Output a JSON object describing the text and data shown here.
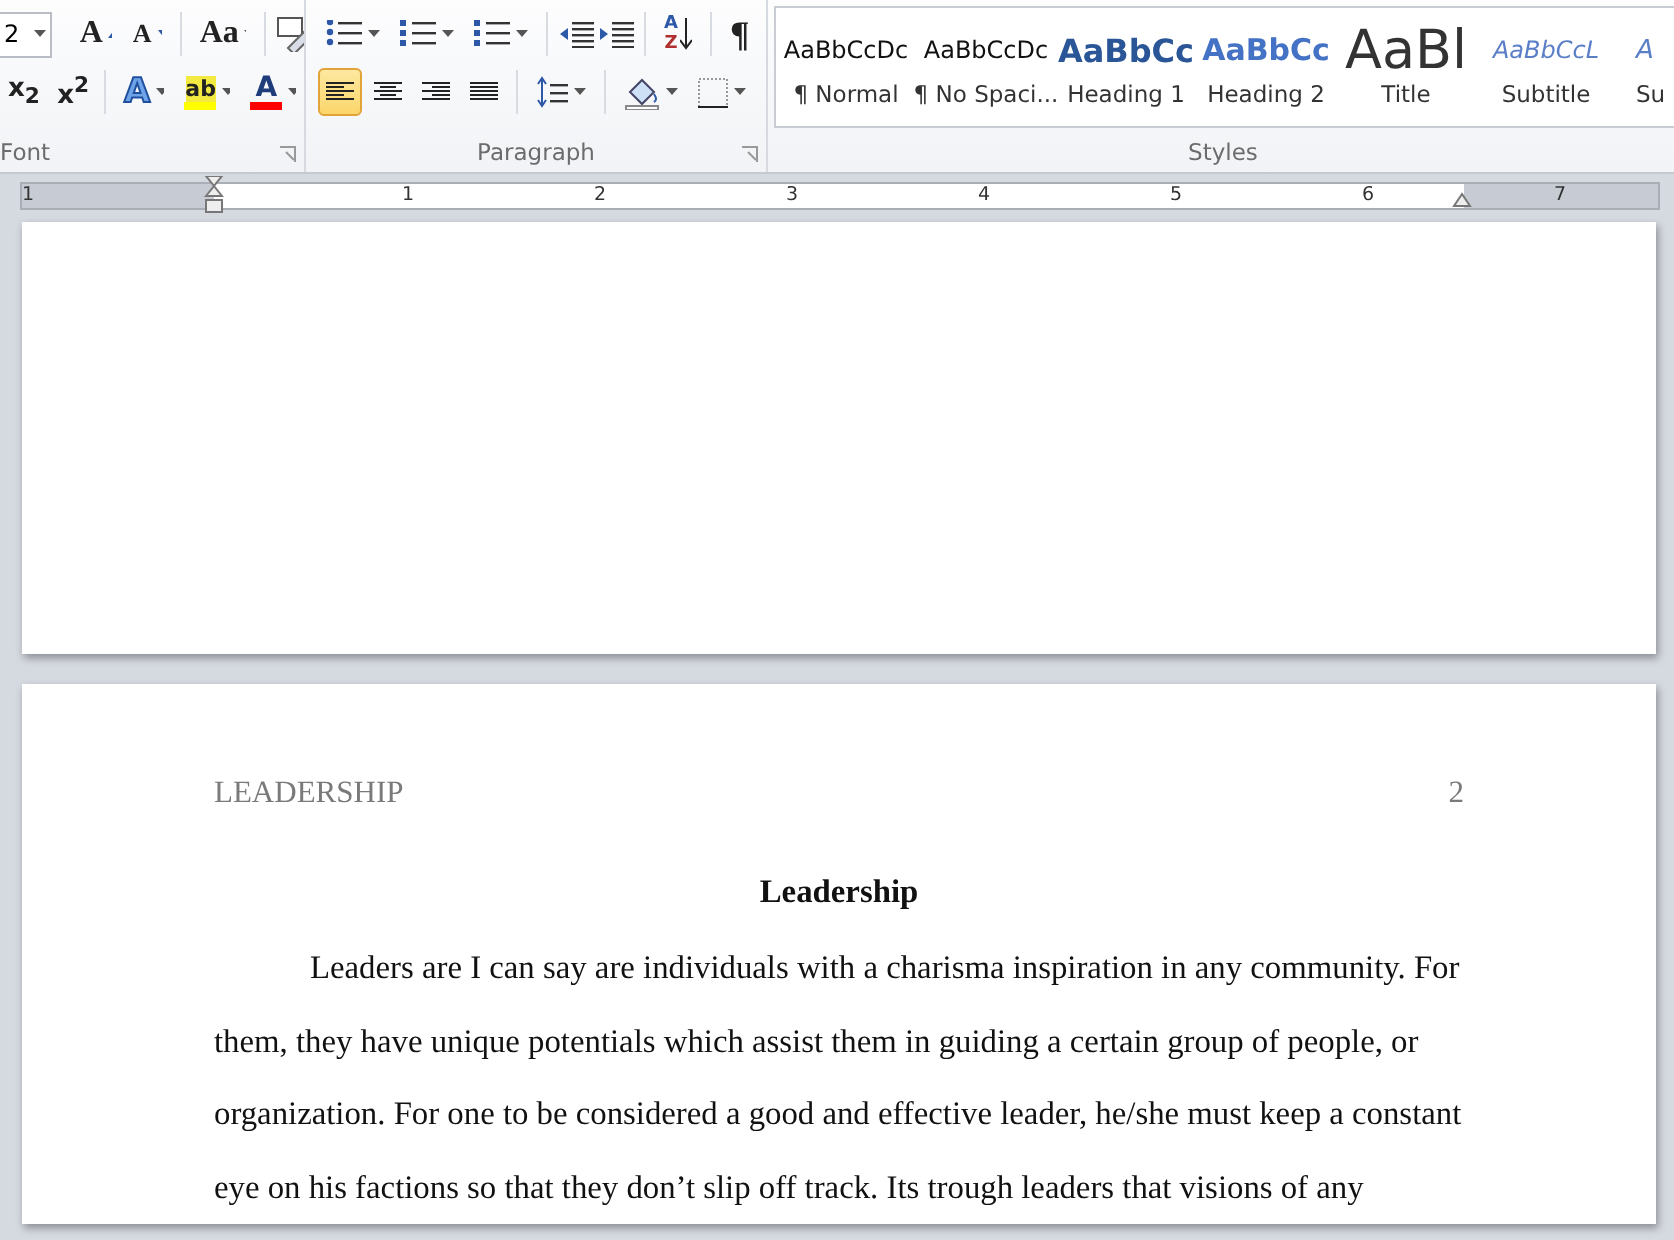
{
  "font_group": {
    "label": "Font",
    "size_value": "2",
    "grow": "A",
    "shrink": "A",
    "change_case": "Aa",
    "subscript": "x$_{2}$",
    "superscript": "x$^{2}$",
    "text_effects": "A",
    "highlight": "ab",
    "font_color": "A"
  },
  "paragraph_group": {
    "label": "Paragraph",
    "sort": [
      "A",
      "Z"
    ],
    "pilcrow": "¶",
    "alignment": [
      {
        "selected": true
      },
      {
        "selected": false
      },
      {
        "selected": false
      },
      {
        "selected": false
      }
    ]
  },
  "styles_group": {
    "label": "Styles",
    "styles": [
      {
        "kind": "normal",
        "preview": "AaBbCcDc",
        "name": "¶ Normal"
      },
      {
        "kind": "normal",
        "preview": "AaBbCcDc",
        "name": "¶ No Spaci..."
      },
      {
        "kind": "heading1",
        "preview": "AaBbCc",
        "name": "Heading 1"
      },
      {
        "kind": "heading2",
        "preview": "AaBbCc",
        "name": "Heading 2"
      },
      {
        "kind": "title",
        "preview": "AaBl",
        "name": "Title"
      },
      {
        "kind": "subtitle",
        "preview": "AaBbCcL",
        "name": "Subtitle"
      },
      {
        "kind": "cut",
        "preview": "A",
        "name": "Su"
      }
    ]
  },
  "ruler": {
    "labels": [
      "1",
      "1",
      "2",
      "3",
      "4",
      "5",
      "6",
      "7"
    ]
  },
  "page_2": {
    "header": "LEADERSHIP",
    "page_number": "2",
    "title": "Leadership",
    "paragraph": "Leaders are I can say are individuals with a charisma inspiration in any community. For them, they have unique potentials which assist them in guiding a certain group of people, or organization. For one to be considered a good and effective leader, he/she must keep a constant eye on his factions so that they don’t slip off track. Its trough leaders that visions of any"
  }
}
